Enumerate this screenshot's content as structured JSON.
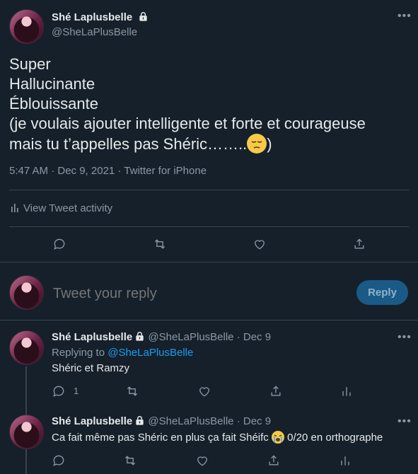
{
  "main_tweet": {
    "display_name": "Shé Laplusbelle",
    "handle": "@SheLaPlusBelle",
    "text_lines": [
      "Super",
      "Hallucinante",
      "Éblouissante",
      "(je voulais ajouter intelligente et forte et courageuse",
      "mais tu t’appelles pas Shéric……..",
      ")"
    ],
    "meta": "5:47 AM · Dec 9, 2021 · Twitter for iPhone",
    "activity_label": "View Tweet activity",
    "emoji": "pensive-face"
  },
  "reply_box": {
    "placeholder": "Tweet your reply",
    "button_label": "Reply",
    "button_color": "#1a5a86"
  },
  "replies": [
    {
      "display_name": "Shé Laplusbelle",
      "handle": "@SheLaPlusBelle",
      "separator": "·",
      "date": "Dec 9",
      "replying_to_prefix": "Replying to ",
      "replying_to_handle": "@SheLaPlusBelle",
      "text": "Shéric et Ramzy",
      "reply_count": "1"
    },
    {
      "display_name": "Shé Laplusbelle",
      "handle": "@SheLaPlusBelle",
      "separator": "·",
      "date": "Dec 9",
      "text_before": "Ca fait même pas Shéric en plus ça fait Shéifc",
      "text_after": " 0/20 en orthographe",
      "emoji": "loudly-crying-face"
    }
  ],
  "colors": {
    "background": "#15202b",
    "divider": "#38444d",
    "muted": "#8b98a5",
    "link": "#1d9bf0"
  }
}
